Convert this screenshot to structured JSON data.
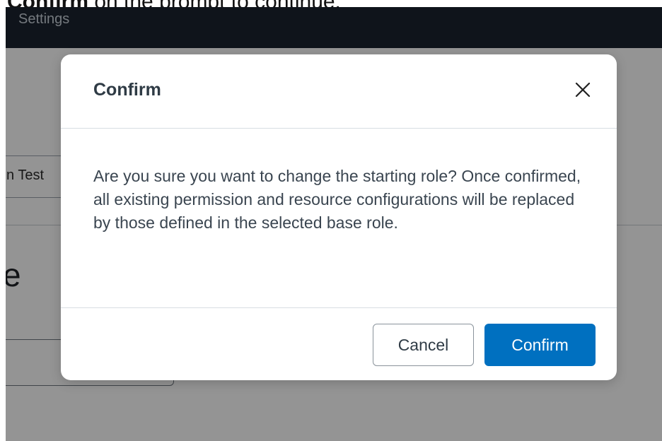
{
  "instruction": {
    "strong": "Confirm",
    "rest": " on the prompt to continue."
  },
  "app": {
    "topbar_title": "Settings",
    "field_text": "n Test",
    "heading_partial": "e"
  },
  "dialog": {
    "title": "Confirm",
    "close_label": "X",
    "message": "Are you sure you want to change the starting role? Once confirmed, all existing permission and resource configurations will be replaced by those defined in the selected base role.",
    "cancel_label": "Cancel",
    "confirm_label": "Confirm"
  },
  "colors": {
    "topbar": "#1b2430",
    "overlay": "rgba(0,0,0,0.42)",
    "primary_button": "#0070c0",
    "dialog_title": "#2f3b45"
  }
}
